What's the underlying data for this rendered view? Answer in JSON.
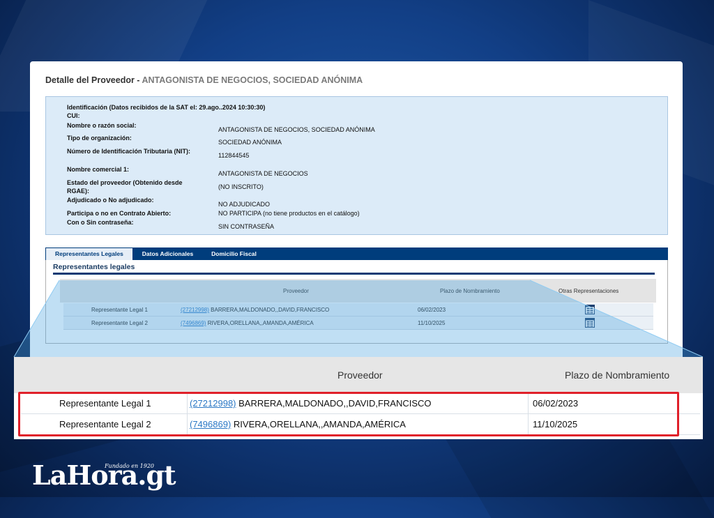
{
  "header": {
    "title": "Detalle del Proveedor -",
    "subtitle": "ANTAGONISTA DE NEGOCIOS, SOCIEDAD ANÓNIMA"
  },
  "identification": {
    "heading": "Identificación (Datos recibidos de la SAT el: 29.ago..2024 10:30:30)",
    "fields": [
      {
        "label": "CUI:",
        "value": ""
      },
      {
        "label": "Nombre o razón social:",
        "value": "ANTAGONISTA DE NEGOCIOS, SOCIEDAD ANÓNIMA"
      },
      {
        "label": "Tipo de organización:",
        "value": "SOCIEDAD ANÓNIMA"
      },
      {
        "label": "Número de Identificación Tributaria (NIT):",
        "value": "112844545"
      },
      {
        "label": "Nombre comercial 1:",
        "value": "ANTAGONISTA DE NEGOCIOS"
      },
      {
        "label": "Estado del proveedor (Obtenido desde RGAE):",
        "value": "(NO INSCRITO)"
      },
      {
        "label": "Adjudicado o No adjudicado:",
        "value": "NO ADJUDICADO"
      },
      {
        "label": "Participa o no en Contrato Abierto:",
        "value": "NO PARTICIPA (no tiene productos en el catálogo)"
      },
      {
        "label": "Con o Sin contraseña:",
        "value": "SIN CONTRASEÑA"
      }
    ]
  },
  "tabs": [
    "Representantes Legales",
    "Datos Adicionales",
    "Domicilio Fiscal"
  ],
  "representatives": {
    "title": "Representantes legales",
    "columns": [
      "Proveedor",
      "Plazo de Nombramiento",
      "Otras Representaciones"
    ],
    "rows": [
      {
        "role": "Representante Legal 1",
        "id": "(27212998)",
        "name": "BARRERA,MALDONADO,,DAVID,FRANCISCO",
        "date": "06/02/2023",
        "icon": "calendar-icon"
      },
      {
        "role": "Representante Legal 2",
        "id": "(7496869)",
        "name": "RIVERA,ORELLANA,,AMANDA,AMÉRICA",
        "date": "11/10/2025",
        "icon": "calendar-icon"
      }
    ]
  },
  "logo": {
    "text": "LaHora.gt",
    "tagline": "Fundado en 1920"
  },
  "colors": {
    "background": "#123f86",
    "tab_bar": "#003d7c",
    "identification_bg": "#dcebf8",
    "highlight": "#e0202a",
    "link": "#2b78c5"
  }
}
